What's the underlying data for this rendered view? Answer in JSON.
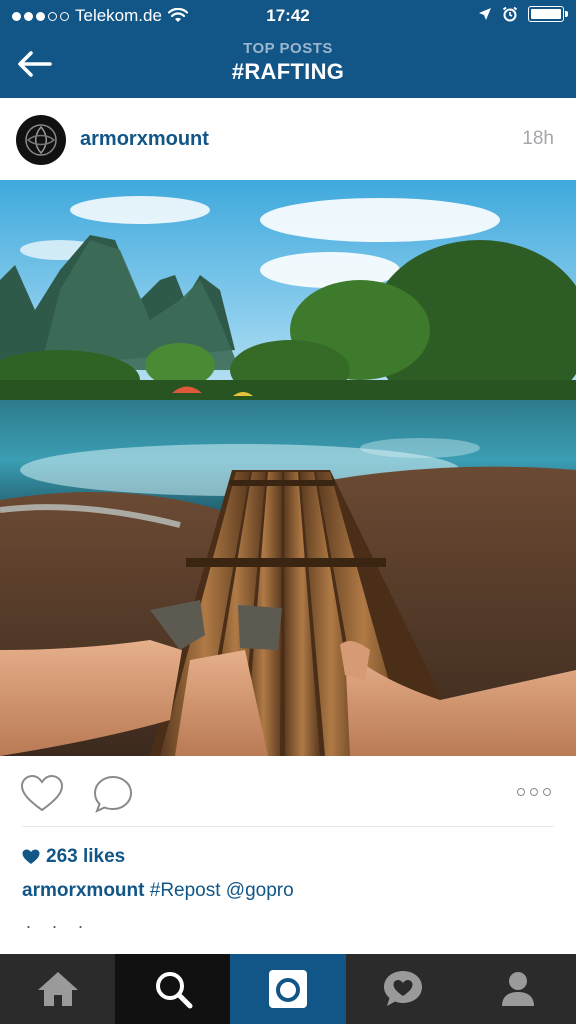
{
  "status_bar": {
    "carrier": "Telekom.de",
    "time": "17:42",
    "signal_bars_filled": 3,
    "signal_bars_total": 5,
    "battery_level": 1.0
  },
  "header": {
    "subtitle": "TOP POSTS",
    "title": "#RAFTING",
    "background_color": "#125688"
  },
  "post": {
    "username": "armorxmount",
    "time_ago": "18h",
    "likes": "263 likes",
    "caption_user": "armorxmount",
    "caption_text": "#Repost @gopro",
    "more_indicator": ". . ."
  },
  "icons": {
    "back": "back-arrow-icon",
    "like": "heart-outline-icon",
    "comment": "comment-bubble-icon",
    "more": "more-options-icon",
    "likes_heart": "heart-filled-icon"
  },
  "tabs": [
    {
      "name": "home",
      "icon": "home-icon"
    },
    {
      "name": "explore",
      "icon": "search-icon",
      "active": true
    },
    {
      "name": "camera",
      "icon": "camera-icon"
    },
    {
      "name": "activity",
      "icon": "activity-heart-bubble-icon"
    },
    {
      "name": "profile",
      "icon": "profile-icon"
    }
  ],
  "colors": {
    "accent": "#125688",
    "tabbar": "#2b2b2b",
    "tab_active": "#111111",
    "muted_text": "#a5a7aa"
  }
}
